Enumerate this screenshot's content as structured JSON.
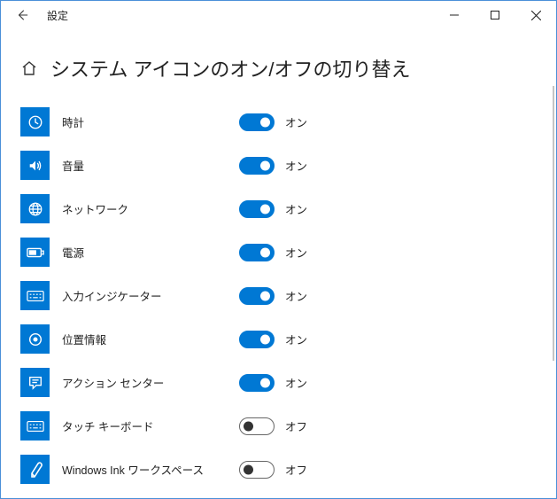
{
  "window_title": "設定",
  "page_title": "システム アイコンのオン/オフの切り替え",
  "labels": {
    "on": "オン",
    "off": "オフ"
  },
  "items": [
    {
      "id": "clock",
      "label": "時計",
      "on": true
    },
    {
      "id": "volume",
      "label": "音量",
      "on": true
    },
    {
      "id": "network",
      "label": "ネットワーク",
      "on": true
    },
    {
      "id": "power",
      "label": "電源",
      "on": true
    },
    {
      "id": "ime",
      "label": "入力インジケーター",
      "on": true
    },
    {
      "id": "location",
      "label": "位置情報",
      "on": true
    },
    {
      "id": "action",
      "label": "アクション センター",
      "on": true
    },
    {
      "id": "touchkb",
      "label": "タッチ キーボード",
      "on": false
    },
    {
      "id": "ink",
      "label": "Windows Ink ワークスペース",
      "on": false
    }
  ]
}
